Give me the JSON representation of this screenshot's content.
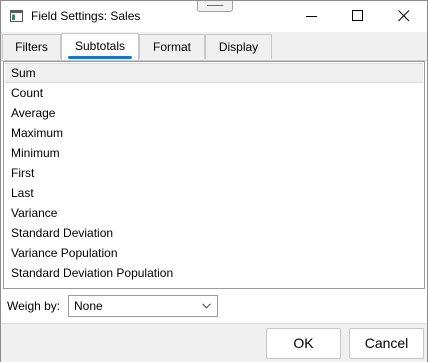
{
  "window": {
    "title": "Field Settings: Sales"
  },
  "titlebar": {
    "icons": [
      "app-icon",
      "drag-handle",
      "minimize-icon",
      "maximize-icon",
      "close-icon"
    ]
  },
  "tabs": [
    {
      "label": "Filters",
      "active": false
    },
    {
      "label": "Subtotals",
      "active": true
    },
    {
      "label": "Format",
      "active": false
    },
    {
      "label": "Display",
      "active": false
    }
  ],
  "subtotals_list": {
    "items": [
      "Sum",
      "Count",
      "Average",
      "Maximum",
      "Minimum",
      "First",
      "Last",
      "Variance",
      "Standard Deviation",
      "Variance Population",
      "Standard Deviation Population"
    ],
    "selected": "Sum"
  },
  "weigh_by": {
    "label": "Weigh by:",
    "value": "None"
  },
  "footer": {
    "ok_label": "OK",
    "cancel_label": "Cancel"
  },
  "colors": {
    "accent": "#1a76d2",
    "selection": "#f0f0f0",
    "chrome": "#f0f0f0"
  }
}
